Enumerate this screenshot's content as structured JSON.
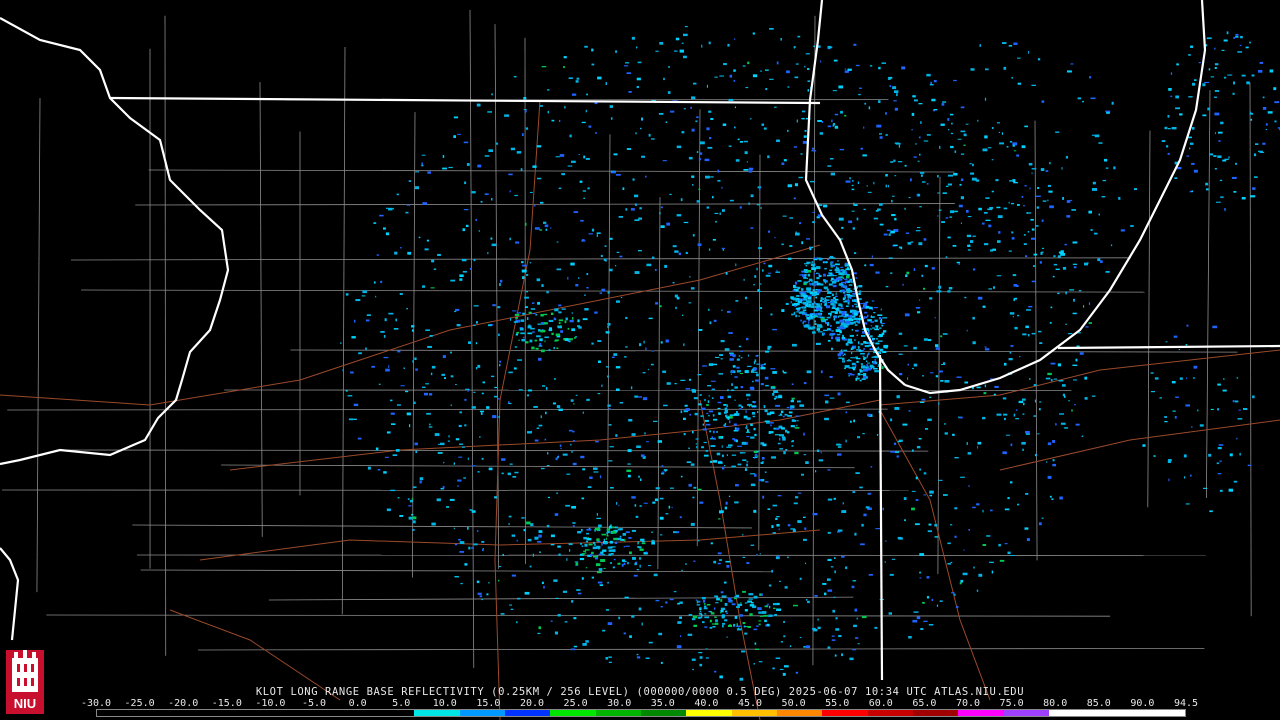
{
  "caption": "KLOT LONG RANGE BASE REFLECTIVITY (0.25KM / 256 LEVEL) (000000/0000 0.5 DEG) 2025-06-07 10:34 UTC  ATLAS.NIU.EDU",
  "logo_text": "NIU",
  "scale": {
    "labels": [
      "-30.0",
      "-25.0",
      "-20.0",
      "-15.0",
      "-10.0",
      "-5.0",
      "0.0",
      "5.0",
      "10.0",
      "15.0",
      "20.0",
      "25.0",
      "30.0",
      "35.0",
      "40.0",
      "45.0",
      "50.0",
      "55.0",
      "60.0",
      "65.0",
      "70.0",
      "75.0",
      "80.0",
      "85.0",
      "90.0",
      "94.5"
    ],
    "colors": [
      "#000000",
      "#000000",
      "#000000",
      "#000000",
      "#000000",
      "#000000",
      "#000000",
      "#00e5e5",
      "#0099ff",
      "#0033ff",
      "#00e600",
      "#00b400",
      "#008800",
      "#ffff00",
      "#ffc000",
      "#ff8800",
      "#ff0000",
      "#c80000",
      "#a00000",
      "#ff00ff",
      "#a040ff",
      "#ffffff",
      "#ffffff",
      "#ffffff"
    ]
  },
  "colors": {
    "state_border": "#ffffff",
    "county_line": "#8c8c8c",
    "highway": "#9b4a2a",
    "echo_light": "#00b4e6",
    "echo_mid": "#1e64ff",
    "echo_green": "#00c850"
  }
}
